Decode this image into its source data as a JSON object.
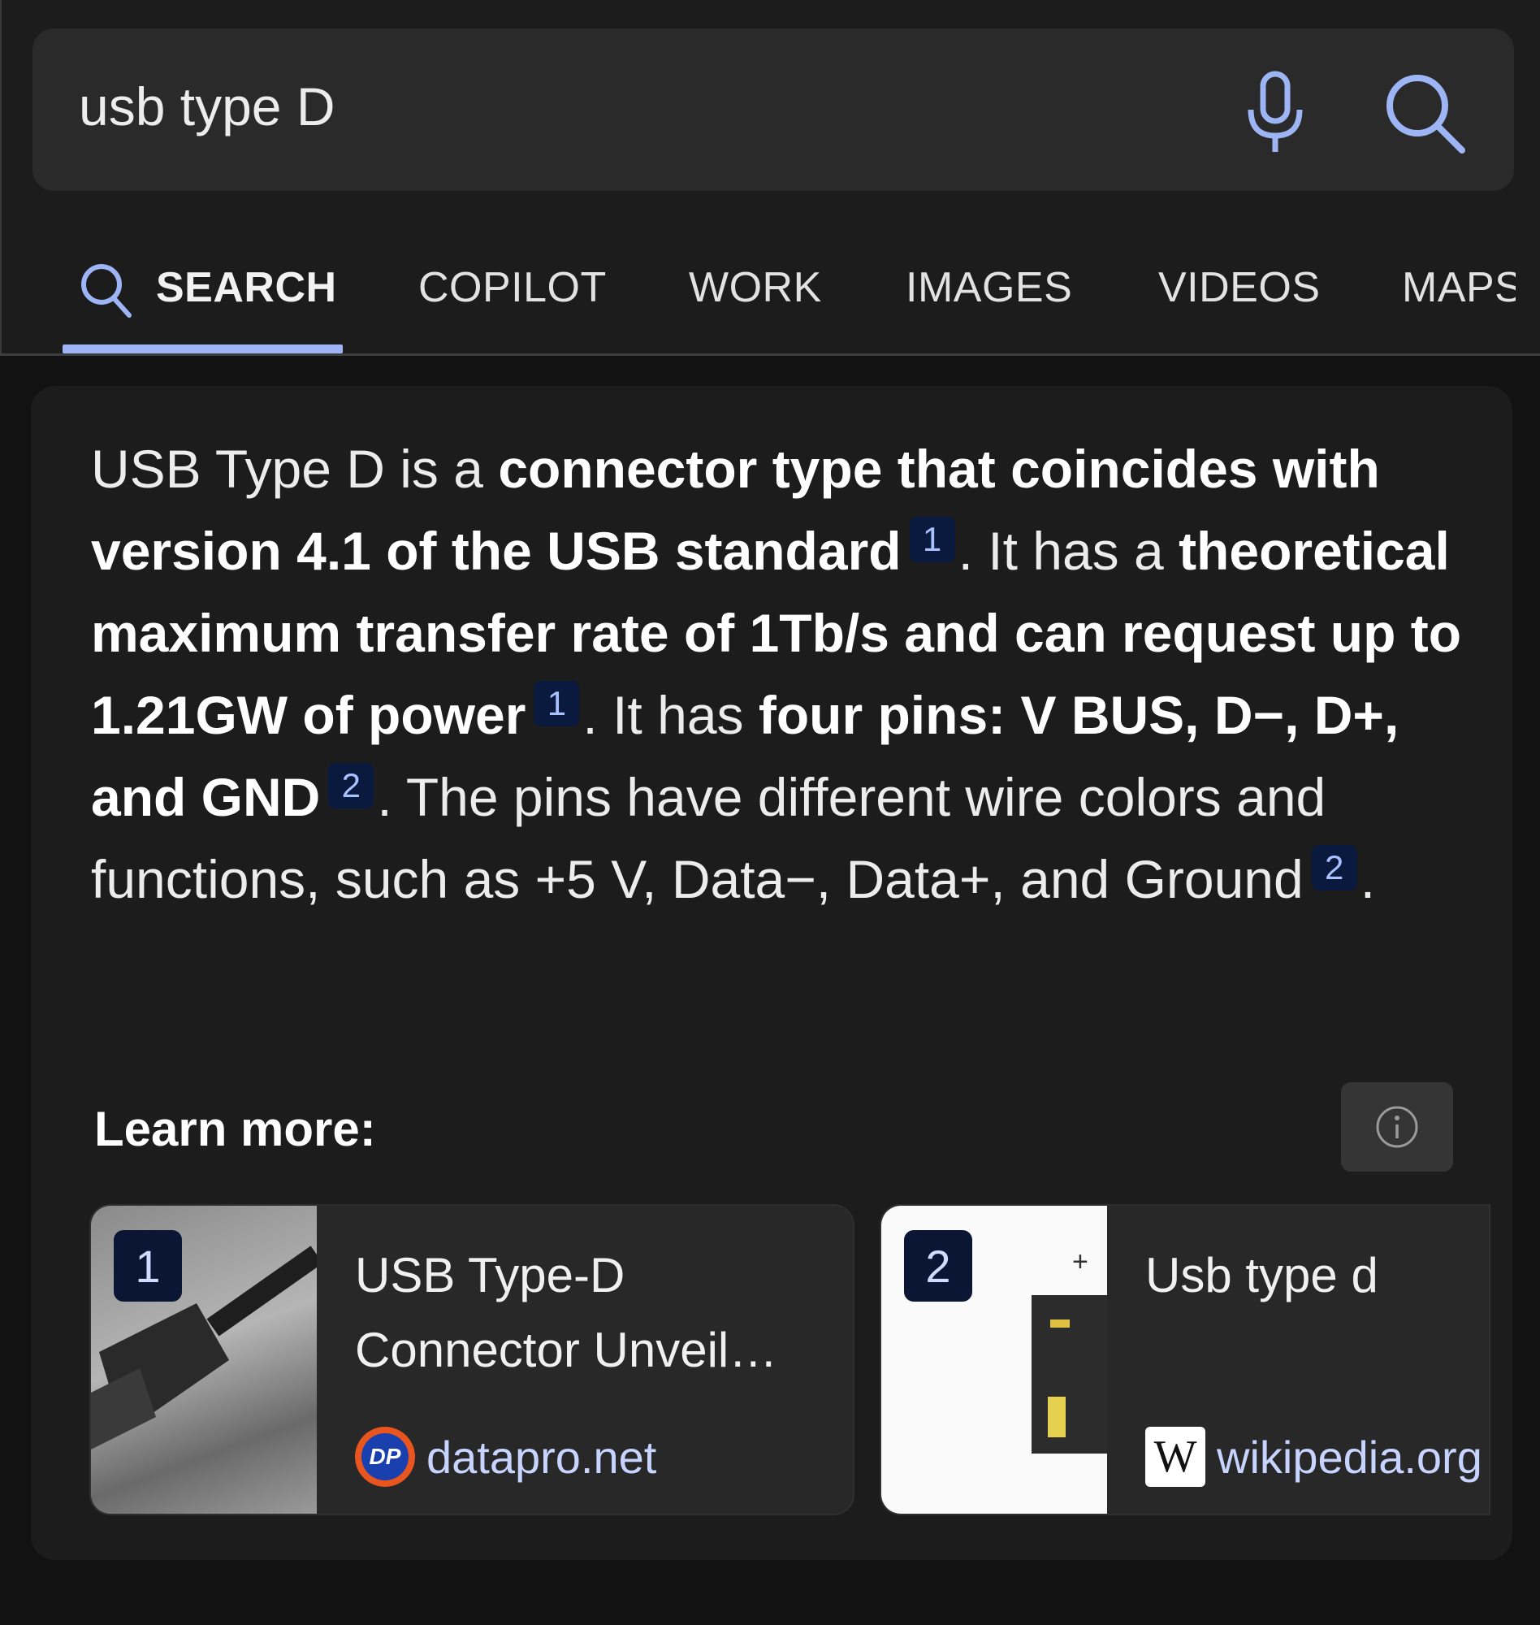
{
  "search": {
    "query": "usb type D",
    "mic_icon": "microphone-icon",
    "search_icon": "search-icon"
  },
  "tabs": [
    {
      "label": "SEARCH",
      "active": true
    },
    {
      "label": "COPILOT"
    },
    {
      "label": "WORK"
    },
    {
      "label": "IMAGES"
    },
    {
      "label": "VIDEOS"
    },
    {
      "label": "MAPS"
    }
  ],
  "accent_color": "#9db4f5",
  "answer": {
    "s1": "USB Type D is a ",
    "b1": "connector type that coincides with version 4.1 of the USB standard",
    "c1": "1",
    "s2": ". It has a ",
    "b2": "theoretical maximum transfer rate of 1Tb/s and can request up to 1.21GW of power",
    "c2": "1",
    "s3": ". It has ",
    "b3": "four pins: V BUS, D−, D+, and GND",
    "c3": "2",
    "s4": ". The pins have different wire colors and functions, such as +5 V, Data−, Data+, and Ground",
    "c4": "2",
    "s5": "."
  },
  "learn_more": {
    "label": "Learn more:",
    "info_icon": "info-icon",
    "sources": [
      {
        "number": "1",
        "title": "USB Type-D Connector Unveil…",
        "site": "datapro.net",
        "favicon_text": "DP"
      },
      {
        "number": "2",
        "title": "Usb type d",
        "site": "wikipedia.org",
        "favicon_text": "W"
      }
    ]
  }
}
